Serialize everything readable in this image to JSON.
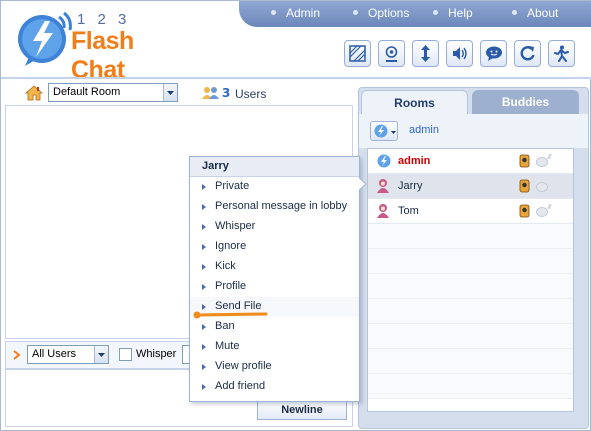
{
  "header": {
    "logo_number": "1 2 3",
    "logo_text": "Flash Chat",
    "nav": [
      {
        "label": "Admin"
      },
      {
        "label": "Options"
      },
      {
        "label": "Help"
      },
      {
        "label": "About"
      }
    ],
    "toolbar_icons": [
      "skin-icon",
      "status-icon",
      "resize-icon",
      "sound-icon",
      "smiley-icon",
      "refresh-icon",
      "logout-icon"
    ]
  },
  "room_bar": {
    "room_select_value": "Default Room",
    "user_count": "3",
    "users_label": "Users"
  },
  "input_bar": {
    "recipient_select_value": "All Users",
    "whisper_label": "Whisper"
  },
  "newline_button": "Newline",
  "right_panel": {
    "tabs": [
      {
        "label": "Rooms"
      },
      {
        "label": "Buddies"
      }
    ],
    "current_user": "admin",
    "users": [
      {
        "name": "admin"
      },
      {
        "name": "Jarry"
      },
      {
        "name": "Tom"
      }
    ]
  },
  "context_menu": {
    "title": "Jarry",
    "items": [
      {
        "label": "Private"
      },
      {
        "label": "Personal message in lobby"
      },
      {
        "label": "Whisper"
      },
      {
        "label": "Ignore"
      },
      {
        "label": "Kick"
      },
      {
        "label": "Profile"
      },
      {
        "label": "Send File"
      },
      {
        "label": "Ban"
      },
      {
        "label": "Mute"
      },
      {
        "label": "View profile"
      },
      {
        "label": "Add friend"
      }
    ]
  },
  "colors": {
    "brand_orange": "#f07e1b",
    "nav_blue": "#7a94c4",
    "admin_red": "#cc0000",
    "accent_blue": "#2f67c8"
  }
}
